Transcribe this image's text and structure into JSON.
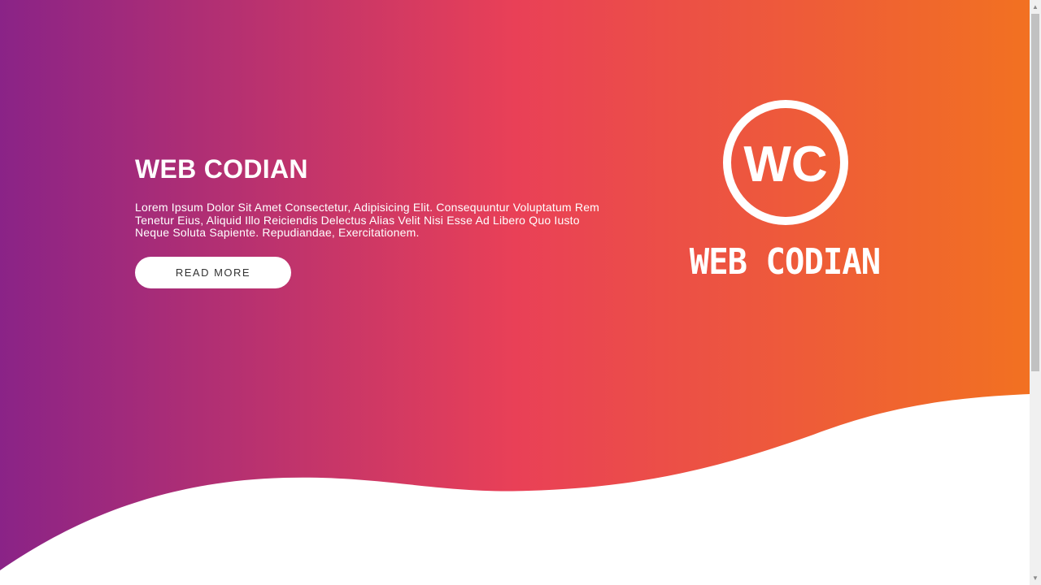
{
  "hero": {
    "title": "WEB CODIAN",
    "description": "Lorem Ipsum Dolor Sit Amet Consectetur, Adipisicing Elit. Consequuntur Voluptatum Rem Tenetur Eius, Aliquid Illo Reiciendis Delectus Alias Velit Nisi Esse Ad Libero Quo Iusto Neque Soluta Sapiente. Repudiandae, Exercitationem.",
    "button_label": "READ MORE",
    "gradient_colors": [
      "#8a2387",
      "#e94057",
      "#f27121"
    ]
  },
  "logo": {
    "monogram": "WC",
    "wordmark": "WEB CODIAN"
  },
  "scrollbar": {
    "up_icon": "▲",
    "down_icon": "▼"
  }
}
